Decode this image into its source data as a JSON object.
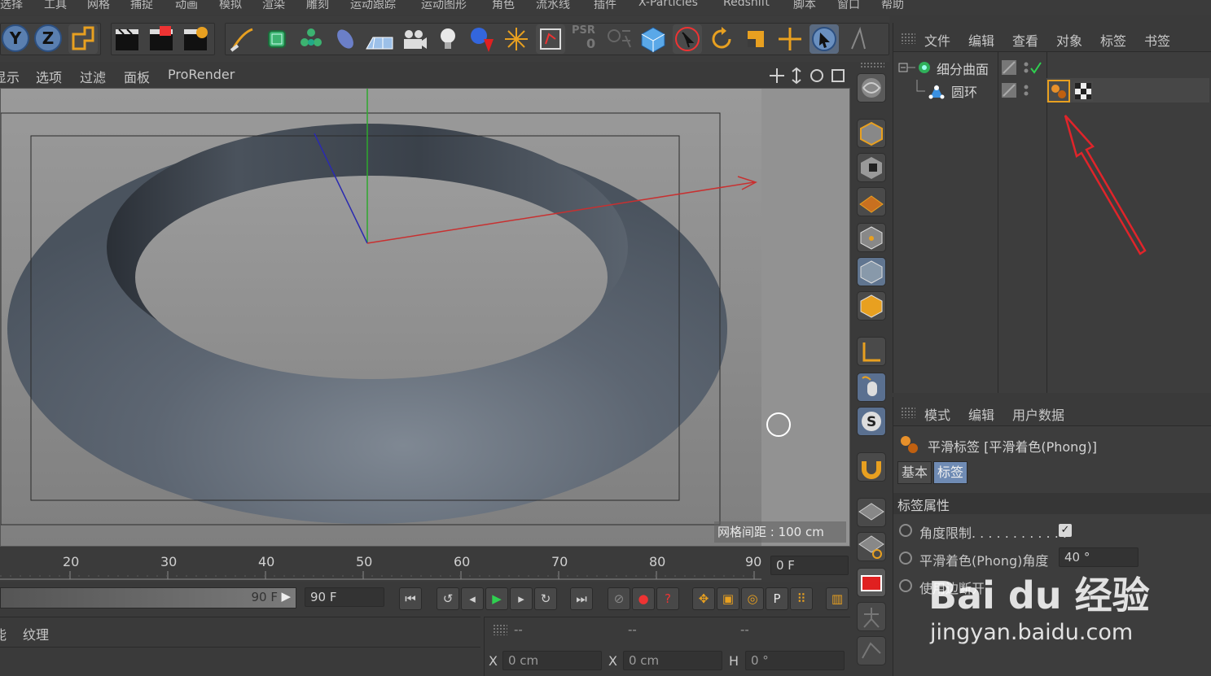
{
  "menubar": {
    "items": [
      "选择",
      "工具",
      "网格",
      "捕捉",
      "动画",
      "模拟",
      "渲染",
      "雕刻",
      "运动跟踪",
      "运动图形",
      "角色",
      "流水线",
      "插件",
      "X-Particles",
      "Redshift",
      "脚本",
      "窗口",
      "帮助"
    ]
  },
  "toolbar": {
    "axis_y": "Y",
    "axis_z": "Z",
    "psr_label": "PSR",
    "psr_value": "0"
  },
  "viewport_menu": {
    "items": [
      "显示",
      "选项",
      "过滤",
      "面板",
      "ProRender"
    ]
  },
  "viewport": {
    "grid_spacing": "网格间距 : 100 cm"
  },
  "object_manager": {
    "menu": [
      "文件",
      "编辑",
      "查看",
      "对象",
      "标签",
      "书签"
    ],
    "objects": [
      {
        "name": "细分曲面"
      },
      {
        "name": "圆环"
      }
    ]
  },
  "attribute_manager": {
    "menu": [
      "模式",
      "编辑",
      "用户数据"
    ],
    "title": "平滑标签 [平滑着色(Phong)]",
    "tabs": [
      "基本",
      "标签"
    ],
    "section": "标签属性",
    "props": {
      "angle_limit": "角度限制. . . . . . . . . . . .",
      "phong_angle_label": "平滑着色(Phong)角度",
      "phong_angle_value": "40 °",
      "use_edge_breaks": "使用边断开"
    }
  },
  "timeline": {
    "ticks": [
      "20",
      "30",
      "40",
      "50",
      "60",
      "70",
      "80",
      "90"
    ],
    "current_frame": "0 F"
  },
  "transport": {
    "range_end": "90 F",
    "max_frame": "90 F"
  },
  "bottom_left": {
    "tabs": [
      "纹理"
    ]
  },
  "coords": {
    "header": [
      "--",
      "--",
      "--"
    ],
    "x_label": "X",
    "x_value": "0 cm",
    "x2_label": "X",
    "x2_value": "0 cm",
    "h_label": "H",
    "h_value": "0 °"
  },
  "watermark": {
    "text": "Bai du 经验",
    "url": "jingyan.baidu.com"
  },
  "colors": {
    "accent_orange": "#e8a020",
    "annotation_red": "#e0242a",
    "panel_bg": "#3d3d3d",
    "torus": "#5c6570"
  }
}
